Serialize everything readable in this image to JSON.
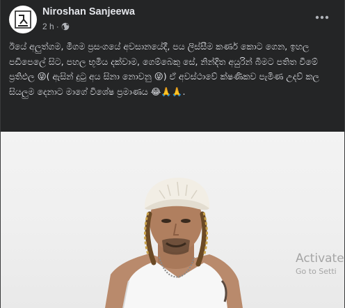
{
  "post": {
    "author": "Niroshan Sanjeewa",
    "time": "2 h",
    "meta_separator": "·",
    "caption": "ඊයේ අලුත්ගම, මීගම ප්‍රසංගයේ අවසානයේදී, පය ලිස්සීම කර්ණ කොට ගෙන, ඉහල පඩිපෙලේ සිට, පහල භූමිය දක්වාම, ගෙම්බෙකු සේ, නින්දිත අයුරින් බිමට පතිත වීමේ ප්‍රතිඵල 😜( ඇසින් දුටු අය සිනා නොවනු 😜) ඒ අවස්ථාවේ ක්ෂණිකව පැමිණ උදව් කල සියලුම දෙනාට මාගේ විශේෂ ප්‍රමාණය 😂🙏🙏.",
    "icons": {
      "privacy": "globe-icon",
      "more": "more-options-icon"
    }
  },
  "watermark": {
    "line1": "Activate",
    "line2": "Go to Setti"
  }
}
